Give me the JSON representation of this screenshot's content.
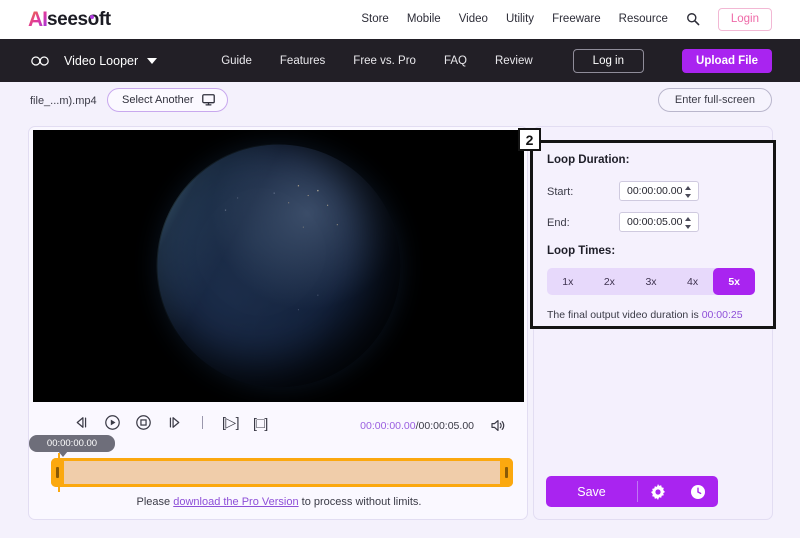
{
  "brand": {
    "logo_a": "AI",
    "logo_rest": "seesoft"
  },
  "topnav": {
    "links": [
      "Store",
      "Mobile",
      "Video",
      "Utility",
      "Freeware",
      "Resource"
    ],
    "search_icon": "search-icon",
    "login_label": "Login"
  },
  "darknav": {
    "loop_icon": "infinity-loop-icon",
    "app_name": "Video Looper",
    "caret_icon": "chevron-down-icon",
    "links": [
      "Guide",
      "Features",
      "Free vs. Pro",
      "FAQ",
      "Review"
    ],
    "login_label": "Log in",
    "upload_label": "Upload File"
  },
  "filerow": {
    "filename": "file_...m).mp4",
    "select_another_label": "Select Another",
    "monitor_icon": "monitor-icon",
    "fullscreen_label": "Enter full-screen"
  },
  "player": {
    "controls": [
      {
        "name": "prev-frame-button",
        "icon": "skip-back-icon"
      },
      {
        "name": "play-button",
        "icon": "play-circle-icon"
      },
      {
        "name": "stop-button",
        "icon": "stop-circle-icon"
      },
      {
        "name": "next-frame-button",
        "icon": "skip-forward-icon"
      }
    ],
    "set_start_label": "[▷]",
    "set_end_label": "[□]",
    "current_time": "00:00:00.00",
    "total_time": "/00:00:05.00",
    "volume_icon": "volume-icon",
    "playhead_tooltip": "00:00:00.00",
    "pro_note_prefix": "Please ",
    "pro_note_link": "download the Pro Version",
    "pro_note_suffix": " to process without limits."
  },
  "panel": {
    "badge": "2",
    "loop_duration_title": "Loop Duration:",
    "start_label": "Start:",
    "start_value": "00:00:00.00",
    "end_label": "End:",
    "end_value": "00:00:05.00",
    "loop_times_title": "Loop Times:",
    "loop_options": [
      "1x",
      "2x",
      "3x",
      "4x",
      "5x"
    ],
    "loop_selected": "5x",
    "final_note_text": "The final output video duration is ",
    "final_duration": "00:00:25"
  },
  "actions": {
    "save_label": "Save",
    "settings_icon": "gear-icon",
    "history_icon": "clock-icon"
  },
  "colors": {
    "accent": "#a924f0",
    "link": "#8e4fd8",
    "timeline": "#fba80f"
  }
}
